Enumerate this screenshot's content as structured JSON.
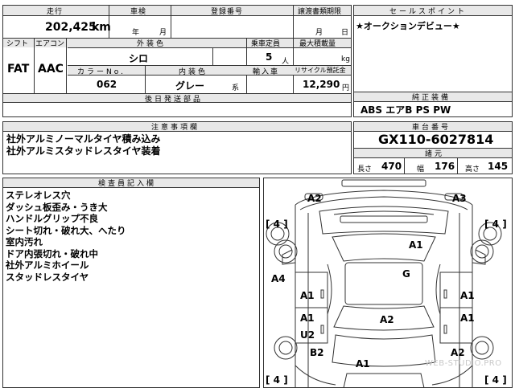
{
  "sheet": {
    "mileage_label": "走行",
    "mileage_value": "202,425",
    "mileage_unit": "km",
    "shaken_label": "車検",
    "shaken_year_unit": "年",
    "shaken_month_unit": "月",
    "plate_label": "登録番号",
    "transfer_label": "譲渡書類期限",
    "transfer_month_unit": "月",
    "transfer_day_unit": "日",
    "shift_label": "シフト",
    "shift_value": "FAT",
    "ac_label": "エアコン",
    "ac_value": "AAC",
    "exterior_color_label": "外装色",
    "exterior_color_value": "シロ",
    "capacity_label": "乗車定員",
    "capacity_value": "5",
    "capacity_unit": "人",
    "max_load_label": "最大積載量",
    "max_load_unit": "kg",
    "color_no_label": "カラーNo.",
    "color_no_value": "062",
    "interior_color_label": "内装色",
    "interior_color_value": "グレー",
    "interior_color_unit": "系",
    "import_label": "輸入車",
    "recycle_label": "リサイクル預託金",
    "recycle_value": "12,290",
    "recycle_unit": "円",
    "later_docs_label": "後日発送部品",
    "sales_point_label": "セールスポイント",
    "sales_point_text": "★オークションデビュー★",
    "options_label": "純正装備",
    "options_text": "ABS エアB PS PW",
    "notes_label": "注意事項欄",
    "notes_lines": [
      "社外アルミノーマルタイヤ積み込み",
      "社外アルミスタッドレスタイヤ装着"
    ],
    "chassis_label": "車台番号",
    "chassis_value": "GX110-6027814",
    "dims_label": "諸元",
    "length_label": "長さ",
    "length_value": "470",
    "width_label": "幅",
    "width_value": "176",
    "height_label": "高さ",
    "height_value": "145",
    "inspector_label": "検査員記入欄",
    "inspector_lines": [
      "ステレオレス穴",
      "ダッシュ板歪み・うき大",
      "ハンドルグリップ不良",
      "シート切れ・破れ大、へたり",
      "室内汚れ",
      "ドア内張切れ・破れ中",
      "社外アルミホイール",
      "スタッドレスタイヤ"
    ],
    "watermark": "WEB-STUDIO.PRO"
  },
  "diagram": {
    "marks": {
      "front_left": "A2",
      "front_right": "A3",
      "tire_fl": "[ 4 ]",
      "tire_fr": "[ 4 ]",
      "hood": "A1",
      "left_side": "A4",
      "roof": "G",
      "door_fl": "A1",
      "door_fr": "A1",
      "door_rl": "A1",
      "door_rr": "A1",
      "rear_roof": "A2",
      "left_lower": "U2",
      "rear_left": "B2",
      "rear_right": "A2",
      "trunk": "A1",
      "tire_rl": "[ 4 ]",
      "tire_rr": "[ 4 ]"
    }
  }
}
